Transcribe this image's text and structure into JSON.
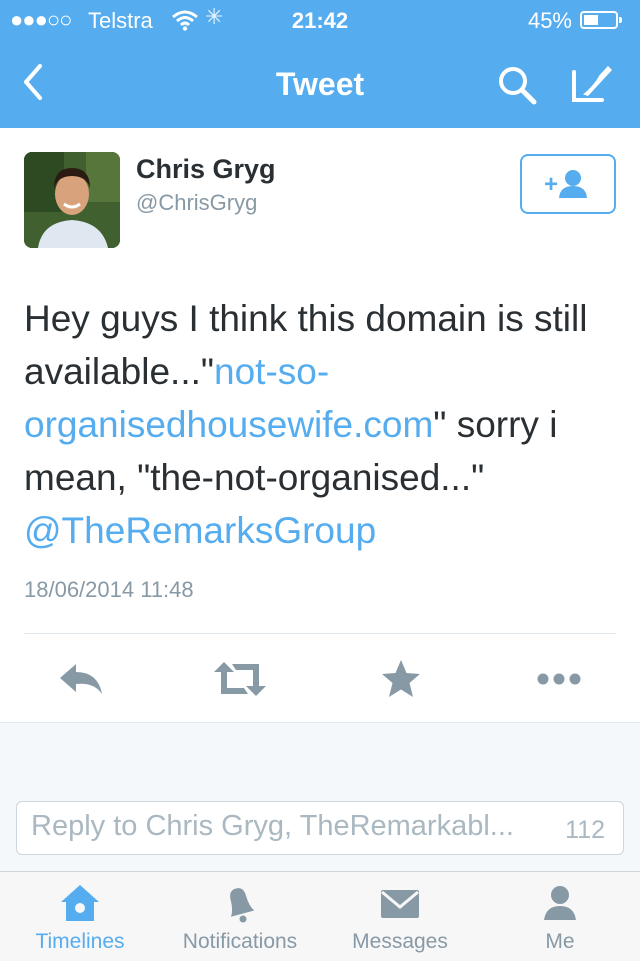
{
  "status_bar": {
    "signal": "●●●○○",
    "carrier": "Telstra",
    "time": "21:42",
    "battery": "45%",
    "battery_level": 0.45
  },
  "nav": {
    "title": "Tweet",
    "back_icon": "chevron-left-icon",
    "search_icon": "search-icon",
    "compose_icon": "compose-quill-icon"
  },
  "tweet": {
    "author_name": "Chris Gryg",
    "author_handle": "@ChrisGryg",
    "text_before": "Hey guys I think this domain is still available...\"",
    "link": "not-so-organisedhousewife.com",
    "text_after": "\" sorry i mean, \"the-not-organised...\"",
    "mention": "@TheRemarksGroup",
    "timestamp": "18/06/2014 11:48"
  },
  "reply": {
    "placeholder": "Reply to Chris Gryg, TheRemarkabl...",
    "count": "112"
  },
  "tabs": [
    {
      "label": "Timelines",
      "icon": "home-icon",
      "active": true
    },
    {
      "label": "Notifications",
      "icon": "bell-icon",
      "active": false
    },
    {
      "label": "Messages",
      "icon": "envelope-icon",
      "active": false
    },
    {
      "label": "Me",
      "icon": "person-icon",
      "active": false
    }
  ],
  "colors": {
    "brand": "#55acee",
    "text": "#292f33",
    "muted": "#8899a6",
    "action_icon": "#8899a6"
  }
}
